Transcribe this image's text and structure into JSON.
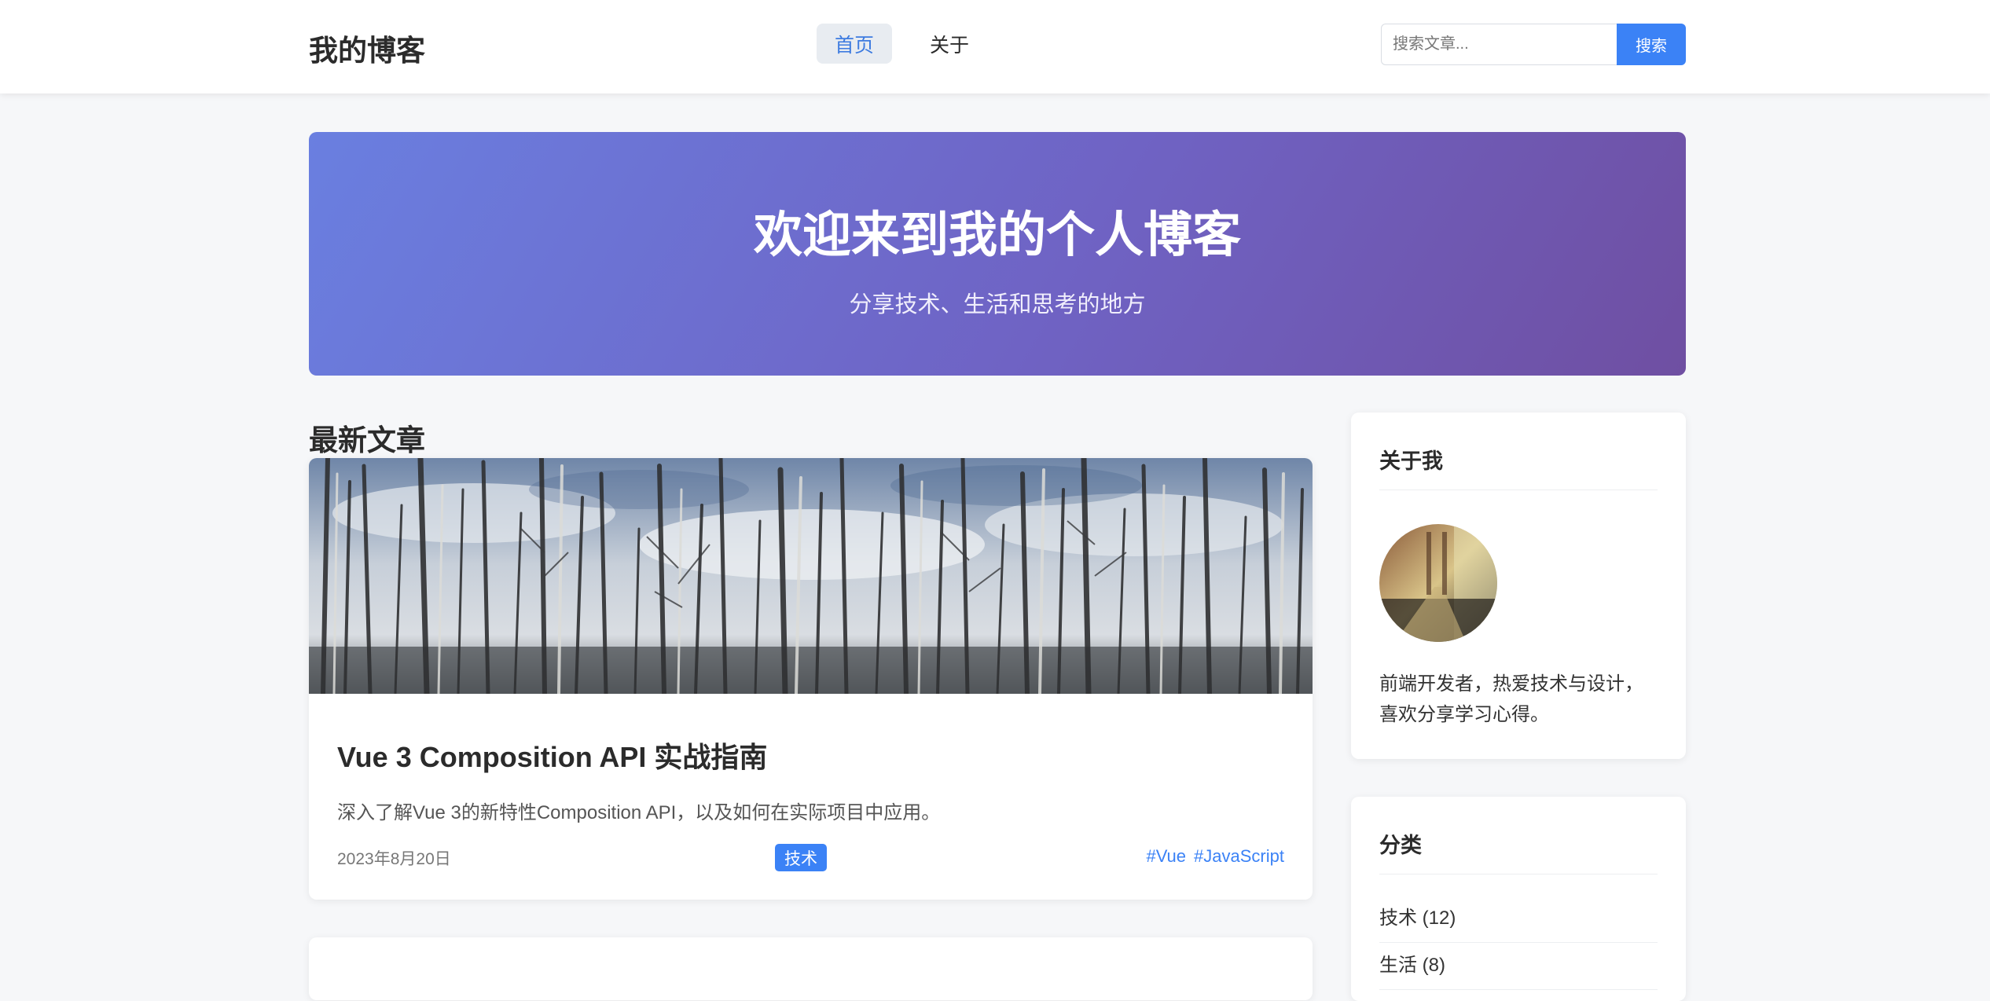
{
  "header": {
    "logo": "我的博客",
    "nav": [
      {
        "label": "首页",
        "active": true
      },
      {
        "label": "关于",
        "active": false
      }
    ],
    "search": {
      "placeholder": "搜索文章...",
      "button": "搜索"
    }
  },
  "hero": {
    "title": "欢迎来到我的个人博客",
    "subtitle": "分享技术、生活和思考的地方"
  },
  "main": {
    "section_title": "最新文章",
    "posts": [
      {
        "title": "Vue 3 Composition API 实战指南",
        "excerpt": "深入了解Vue 3的新特性Composition API，以及如何在实际项目中应用。",
        "date": "2023年8月20日",
        "category": "技术",
        "tags": [
          "#Vue",
          "#JavaScript"
        ]
      }
    ]
  },
  "sidebar": {
    "about": {
      "title": "关于我",
      "bio_line1": "前端开发者，热爱技术与设计，",
      "bio_line2": "喜欢分享学习心得。"
    },
    "categories": {
      "title": "分类",
      "items": [
        {
          "label": "技术 (12)"
        },
        {
          "label": "生活 (8)"
        }
      ]
    }
  },
  "colors": {
    "accent": "#3b82f6",
    "hero_gradient": [
      "#6a7fe0",
      "#6f4fa2"
    ],
    "page_bg": "#f6f7f9"
  }
}
